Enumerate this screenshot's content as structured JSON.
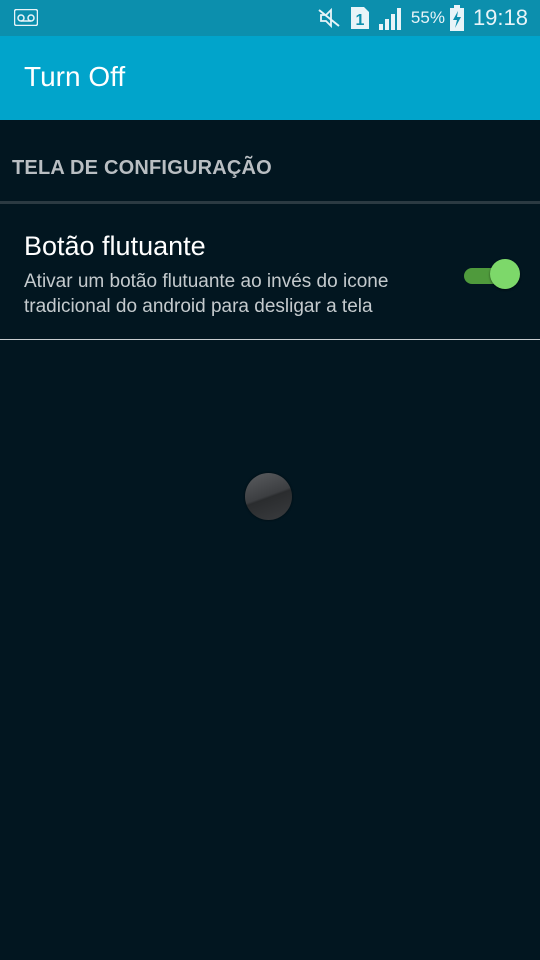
{
  "status_bar": {
    "icons": {
      "left": "voicemail-icon",
      "mute": "vibrate-off-icon",
      "sim": "sim-1-icon",
      "signal": "signal-icon",
      "battery": "battery-charging-icon"
    },
    "sim_label": "1",
    "battery_percent": "55%",
    "time": "19:18"
  },
  "app_bar": {
    "title": "Turn Off"
  },
  "settings": {
    "section_header": "TELA DE CONFIGURAÇÃO",
    "floating_button_pref": {
      "title": "Botão flutuante",
      "summary": "Ativar um botão flutuante ao invés do icone tradicional do android para desligar a tela",
      "enabled": true
    }
  },
  "colors": {
    "status_bar": "#0c8fad",
    "app_bar": "#01a4cb",
    "background": "#021620",
    "switch_on": "#7dd86a"
  }
}
